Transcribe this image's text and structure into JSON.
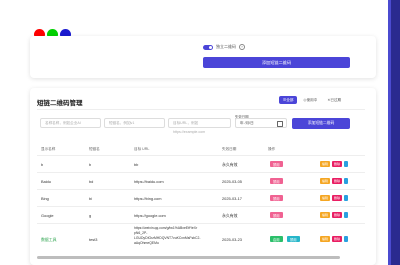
{
  "colors": {
    "dot_red": "#ff0000",
    "dot_green": "#00d000",
    "dot_blue": "#1a1ad0",
    "accent": "#4b45d8"
  },
  "top": {
    "toggle_label": "独立二维码",
    "help_glyph": "?",
    "add_button": "添加短链二维码"
  },
  "main": {
    "title": "短链二维码管理",
    "view_buttons": [
      "全部",
      "使用中",
      "已过期"
    ],
    "filters": {
      "name_placeholder": "名称名称，例如企业AI",
      "code_placeholder": "短链名，例如v1",
      "url_placeholder": "目标URL，例如https://example.com",
      "date_label": "失效日期",
      "date_value": "年 /月/日"
    },
    "add_button": "添加短链二维码",
    "columns": [
      "显示名称",
      "短链名",
      "目标 URL",
      "失效日期",
      "操作"
    ],
    "rows": [
      {
        "name": "b",
        "code": "b",
        "url": "bb",
        "expiry": "永久有效",
        "tags": [
          "禁用"
        ]
      },
      {
        "name": "Baidu",
        "code": "bd",
        "url": "https://baidu.com",
        "expiry": "2025-03-05",
        "tags": [
          "禁用"
        ]
      },
      {
        "name": "Bing",
        "code": "bi",
        "url": "https://bing.com",
        "expiry": "2025-03-17",
        "tags": [
          "禁用"
        ]
      },
      {
        "name": "Google",
        "code": "g",
        "url": "https://google.com",
        "expiry": "永久有效",
        "tags": [
          "禁用"
        ]
      },
      {
        "name": "数据工具",
        "code": "test3",
        "url_lines": [
          "https://weixin.qq.com/g/tw1%ABxeEtfYeXr",
          "pN6_2P-",
          "LGUDyDIGrzMHDQVNT7vuKCxnMsFsbC2-",
          "aAqOhmeQEMu"
        ],
        "expiry": "2025-03-23",
        "tags": [
          "启用",
          "禁用"
        ]
      }
    ],
    "row_actions": [
      "编辑",
      "删除"
    ]
  }
}
